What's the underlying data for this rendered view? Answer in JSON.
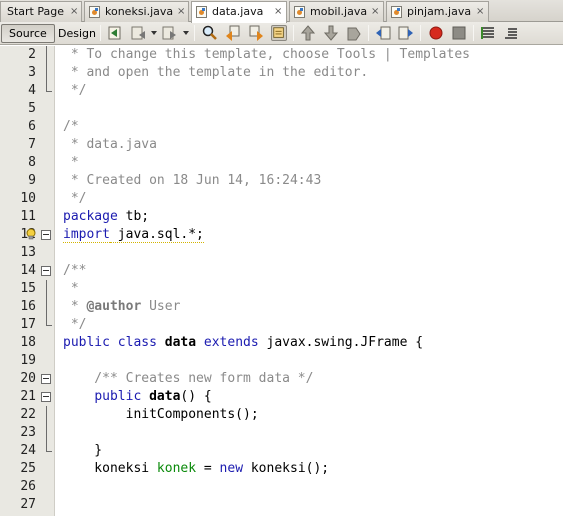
{
  "tabs": [
    {
      "label": "Start Page",
      "active": false,
      "has_icon": false
    },
    {
      "label": "koneksi.java",
      "active": false,
      "has_icon": true
    },
    {
      "label": "data.java",
      "active": true,
      "has_icon": true
    },
    {
      "label": "mobil.java",
      "active": false,
      "has_icon": true
    },
    {
      "label": "pinjam.java",
      "active": false,
      "has_icon": true
    }
  ],
  "tab_close_glyph": "×",
  "toolbar": {
    "source_label": "Source",
    "design_label": "Design"
  },
  "colors": {
    "keyword": "#1b1bb0",
    "comment": "#8a8a8a",
    "field": "#0a8a0a",
    "gutter_bg": "#e9e8e2",
    "warning": "#d4b400",
    "breakpoint": "#d62a1e"
  },
  "editor": {
    "lines": [
      {
        "n": "2",
        "fold": "line",
        "parts": [
          {
            "t": " * To change this template, choose Tools | Templates",
            "c": "com"
          }
        ]
      },
      {
        "n": "3",
        "fold": "line",
        "parts": [
          {
            "t": " * and open the template in the editor.",
            "c": "com"
          }
        ]
      },
      {
        "n": "4",
        "fold": "end",
        "parts": [
          {
            "t": " */",
            "c": "com"
          }
        ]
      },
      {
        "n": "5",
        "fold": "",
        "parts": []
      },
      {
        "n": "6",
        "fold": "",
        "parts": [
          {
            "t": "/*",
            "c": "com"
          }
        ]
      },
      {
        "n": "7",
        "fold": "",
        "parts": [
          {
            "t": " * data.java",
            "c": "com"
          }
        ]
      },
      {
        "n": "8",
        "fold": "",
        "parts": [
          {
            "t": " *",
            "c": "com"
          }
        ]
      },
      {
        "n": "9",
        "fold": "",
        "parts": [
          {
            "t": " * Created on 18 Jun 14, 16:24:43",
            "c": "com"
          }
        ]
      },
      {
        "n": "10",
        "fold": "",
        "parts": [
          {
            "t": " */",
            "c": "com"
          }
        ]
      },
      {
        "n": "11",
        "fold": "",
        "parts": [
          {
            "t": "package",
            "c": "kw"
          },
          {
            "t": " tb;",
            "c": ""
          }
        ]
      },
      {
        "n": "12",
        "fold": "box",
        "hint": true,
        "parts": [
          {
            "t": "import",
            "c": "kw warn"
          },
          {
            "t": " java.sql.*;",
            "c": "warn"
          }
        ]
      },
      {
        "n": "13",
        "fold": "",
        "parts": []
      },
      {
        "n": "14",
        "fold": "box",
        "parts": [
          {
            "t": "/**",
            "c": "com"
          }
        ]
      },
      {
        "n": "15",
        "fold": "line",
        "parts": [
          {
            "t": " *",
            "c": "com"
          }
        ]
      },
      {
        "n": "16",
        "fold": "line",
        "parts": [
          {
            "t": " * ",
            "c": "com"
          },
          {
            "t": "@author",
            "c": "tag"
          },
          {
            "t": " User",
            "c": "com"
          }
        ]
      },
      {
        "n": "17",
        "fold": "end",
        "parts": [
          {
            "t": " */",
            "c": "com"
          }
        ]
      },
      {
        "n": "18",
        "fold": "",
        "parts": [
          {
            "t": "public class",
            "c": "kw"
          },
          {
            "t": " ",
            "c": ""
          },
          {
            "t": "data",
            "c": "bold"
          },
          {
            "t": " ",
            "c": ""
          },
          {
            "t": "extends",
            "c": "kw"
          },
          {
            "t": " javax.swing.JFrame {",
            "c": ""
          }
        ]
      },
      {
        "n": "19",
        "fold": "",
        "parts": []
      },
      {
        "n": "20",
        "fold": "box",
        "parts": [
          {
            "t": "    /** Creates new form data */",
            "c": "com"
          }
        ]
      },
      {
        "n": "21",
        "fold": "box",
        "parts": [
          {
            "t": "    ",
            "c": ""
          },
          {
            "t": "public",
            "c": "kw"
          },
          {
            "t": " ",
            "c": ""
          },
          {
            "t": "data",
            "c": "bold"
          },
          {
            "t": "() {",
            "c": ""
          }
        ]
      },
      {
        "n": "22",
        "fold": "line",
        "parts": [
          {
            "t": "        initComponents();",
            "c": ""
          }
        ]
      },
      {
        "n": "23",
        "fold": "line",
        "parts": []
      },
      {
        "n": "24",
        "fold": "end",
        "parts": [
          {
            "t": "    }",
            "c": ""
          }
        ]
      },
      {
        "n": "25",
        "fold": "",
        "parts": [
          {
            "t": "    koneksi ",
            "c": ""
          },
          {
            "t": "konek",
            "c": "field"
          },
          {
            "t": " = ",
            "c": ""
          },
          {
            "t": "new",
            "c": "kw"
          },
          {
            "t": " koneksi();",
            "c": ""
          }
        ]
      },
      {
        "n": "26",
        "fold": "",
        "parts": []
      },
      {
        "n": "27",
        "fold": "",
        "parts": []
      }
    ]
  }
}
